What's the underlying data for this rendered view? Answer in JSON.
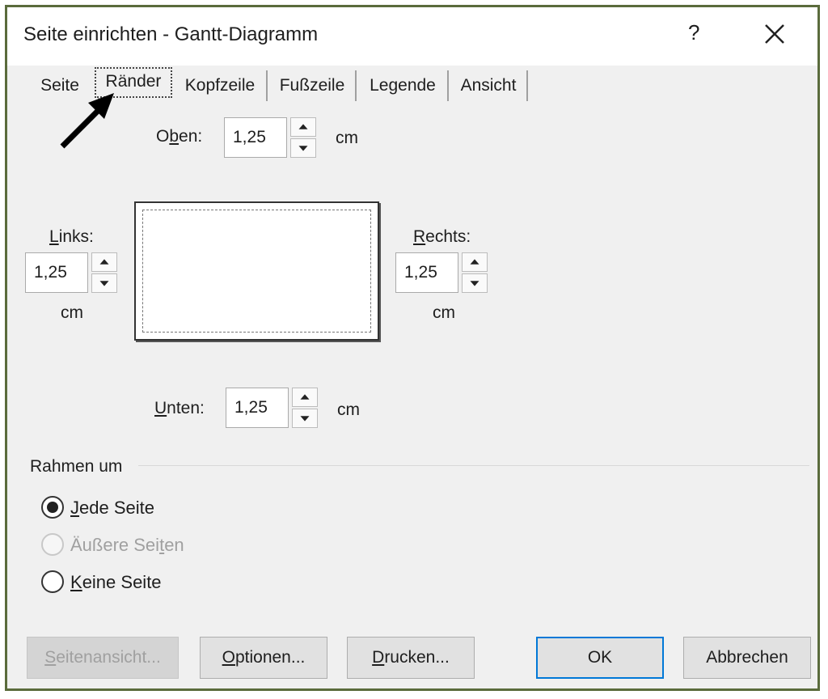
{
  "dialog": {
    "title": "Seite einrichten - Gantt-Diagramm",
    "help": "?",
    "close": "×"
  },
  "tabs": [
    {
      "label": "Seite"
    },
    {
      "label": "Ränder",
      "active": true
    },
    {
      "label": "Kopfzeile"
    },
    {
      "label": "Fußzeile"
    },
    {
      "label": "Legende"
    },
    {
      "label": "Ansicht"
    }
  ],
  "margins": {
    "top": {
      "label_pre": "O",
      "label_u": "b",
      "label_post": "en:",
      "value": "1,25",
      "unit": "cm"
    },
    "left": {
      "label_u": "L",
      "label_post": "inks:",
      "value": "1,25",
      "unit": "cm"
    },
    "right": {
      "label_u": "R",
      "label_post": "echts:",
      "value": "1,25",
      "unit": "cm"
    },
    "bottom": {
      "label_u": "U",
      "label_post": "nten:",
      "value": "1,25",
      "unit": "cm"
    }
  },
  "frame_group": {
    "title": "Rahmen um",
    "options": [
      {
        "label_u": "J",
        "label_post": "ede Seite",
        "checked": true,
        "disabled": false
      },
      {
        "label_pre": "Äußere Sei",
        "label_u": "t",
        "label_post": "en",
        "checked": false,
        "disabled": true
      },
      {
        "label_u": "K",
        "label_post": "eine Seite",
        "checked": false,
        "disabled": false
      }
    ]
  },
  "buttons": {
    "preview": {
      "label_u": "S",
      "label_post": "eitenansicht..."
    },
    "options": {
      "label_u": "O",
      "label_post": "ptionen..."
    },
    "print": {
      "label_u": "D",
      "label_post": "rucken..."
    },
    "ok": {
      "label": "OK"
    },
    "cancel": {
      "label": "Abbrechen"
    }
  },
  "annotation": {
    "icon": "arrow-icon",
    "color": "#000000"
  }
}
